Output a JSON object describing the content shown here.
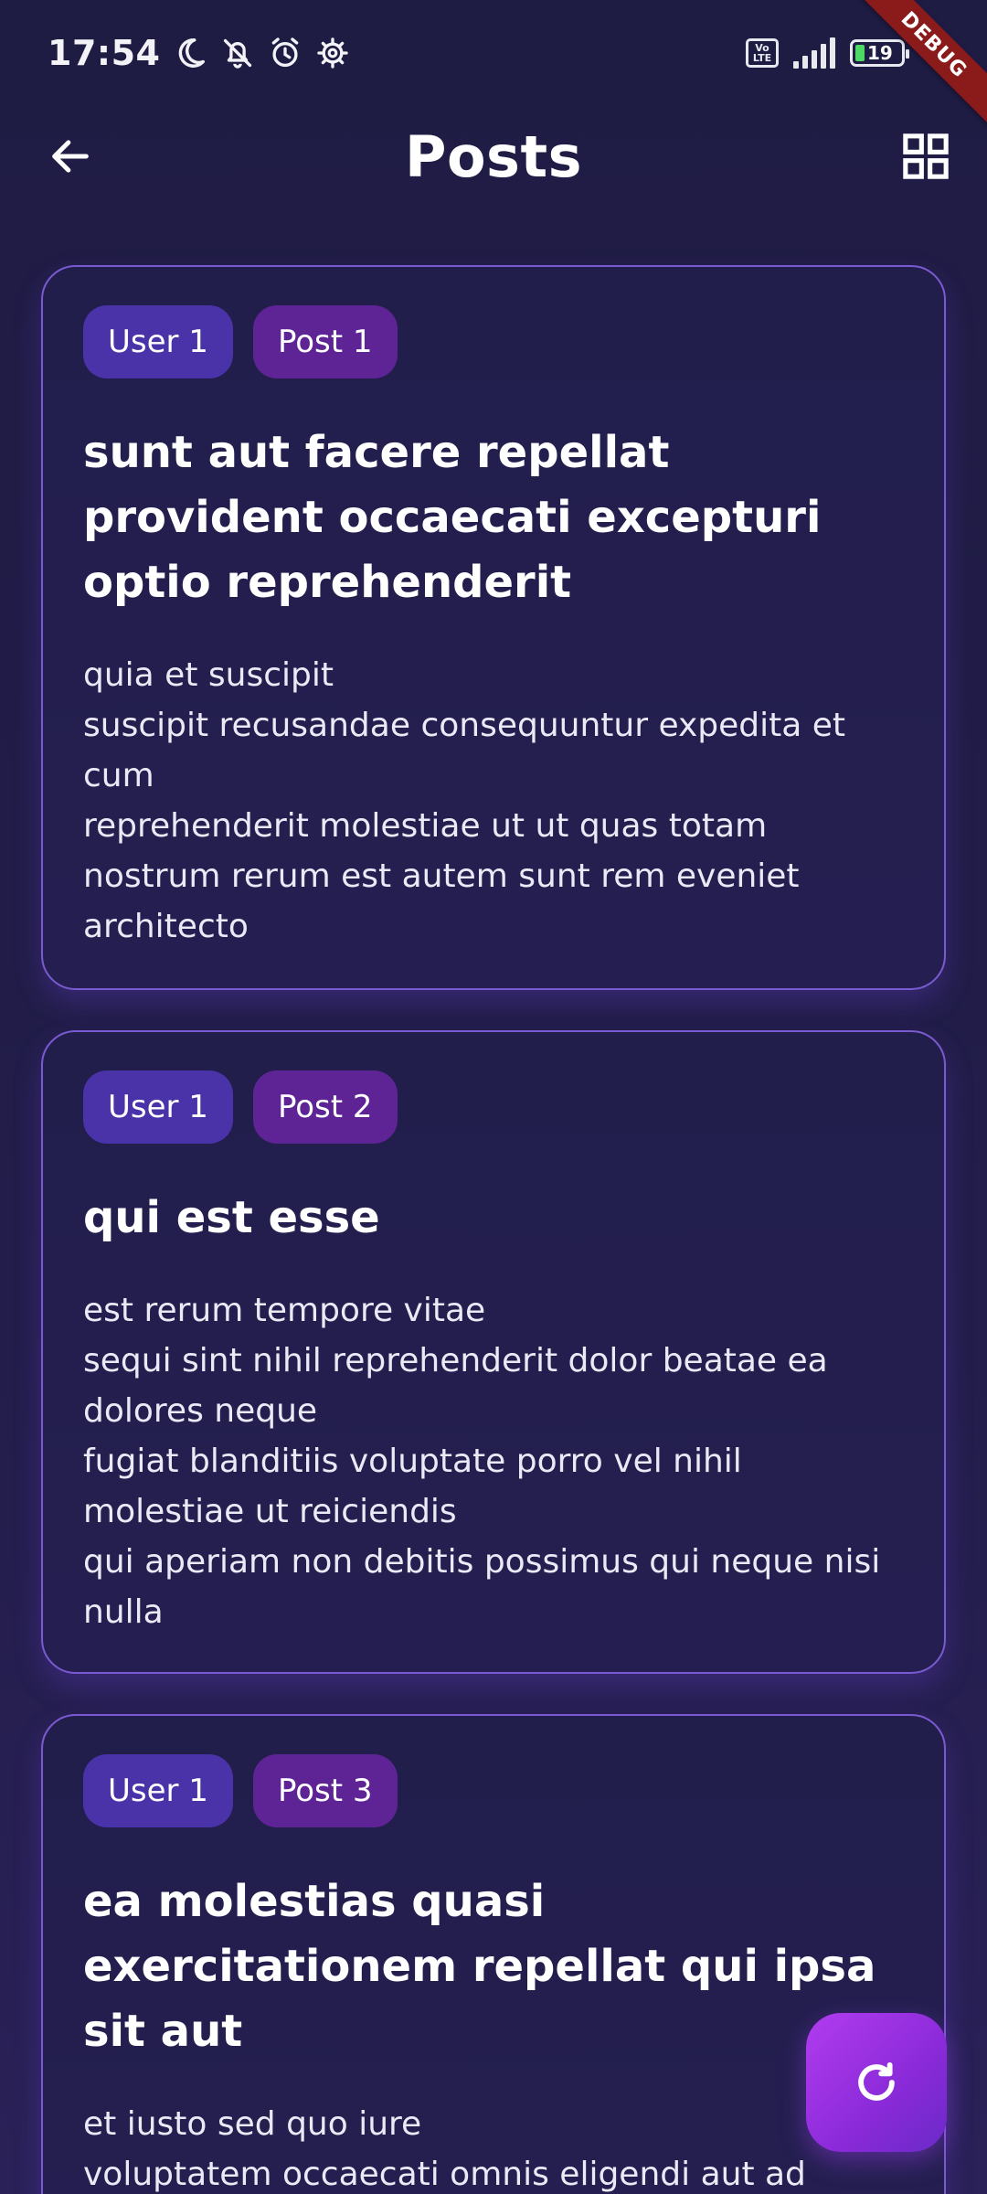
{
  "status_bar": {
    "time": "17:54",
    "icons": [
      "moon-icon",
      "bell-off-icon",
      "alarm-icon",
      "settings-icon"
    ],
    "volte_top": "Vo",
    "volte_bottom": "LTE",
    "battery_level": "19",
    "battery_color": "#4cd964"
  },
  "debug_banner": "DEBUG",
  "app_bar": {
    "title": "Posts"
  },
  "posts": [
    {
      "user_chip": "User 1",
      "post_chip": "Post 1",
      "title": "sunt aut facere repellat provident occaecati excepturi optio reprehenderit",
      "body": "quia et suscipit\nsuscipit recusandae consequuntur expedita et cum\nreprehenderit molestiae ut ut quas totam\nnostrum rerum est autem sunt rem eveniet architecto"
    },
    {
      "user_chip": "User 1",
      "post_chip": "Post 2",
      "title": "qui est esse",
      "body": "est rerum tempore vitae\nsequi sint nihil reprehenderit dolor beatae ea dolores neque\nfugiat blanditiis voluptate porro vel nihil molestiae ut reiciendis\nqui aperiam non debitis possimus qui neque nisi nulla"
    },
    {
      "user_chip": "User 1",
      "post_chip": "Post 3",
      "title": "ea molestias quasi exercitationem repellat qui ipsa sit aut",
      "body": "et iusto sed quo iure\nvoluptatem occaecati omnis eligendi aut ad"
    }
  ],
  "colors": {
    "background": "#1f1c44",
    "card_border": "#7a5ad0",
    "user_chip": "#4a32a8",
    "post_chip": "#5e2496",
    "fab": "#b23cf0"
  }
}
